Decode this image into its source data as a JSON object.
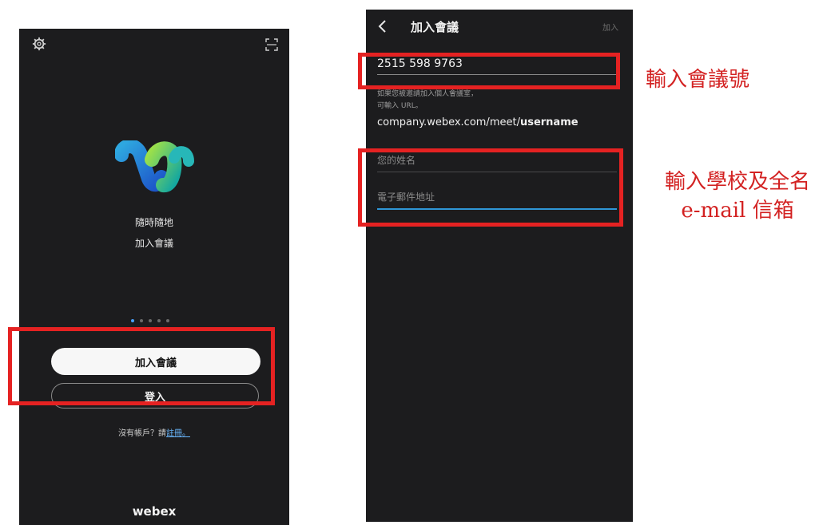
{
  "left_screen": {
    "tagline_line1": "隨時隨地",
    "tagline_line2": "加入會議",
    "join_button": "加入會議",
    "signin_button": "登入",
    "register_prompt": "沒有帳戶？請",
    "register_link": "註冊。",
    "brand": "webex",
    "page_indicator": {
      "total": 5,
      "active": 1
    }
  },
  "right_screen": {
    "title": "加入會議",
    "join_action": "加入",
    "meeting_number": "2515 598 9763",
    "hint_line1": "如果您被邀請加入個人會議室，",
    "hint_line2": "可輸入 URL。",
    "url_prefix": "company.webex.com/meet/",
    "url_bold": "username",
    "name_placeholder": "您的姓名",
    "email_placeholder": "電子郵件地址"
  },
  "annotations": {
    "note_meeting_number": "輸入會議號",
    "note_name_line1": "輸入學校及全名",
    "note_name_line2": "e-mail 信箱"
  },
  "colors": {
    "annotation_red": "#e52222",
    "phone_background": "#1c1c1e",
    "accent_blue": "#2f96d6"
  }
}
